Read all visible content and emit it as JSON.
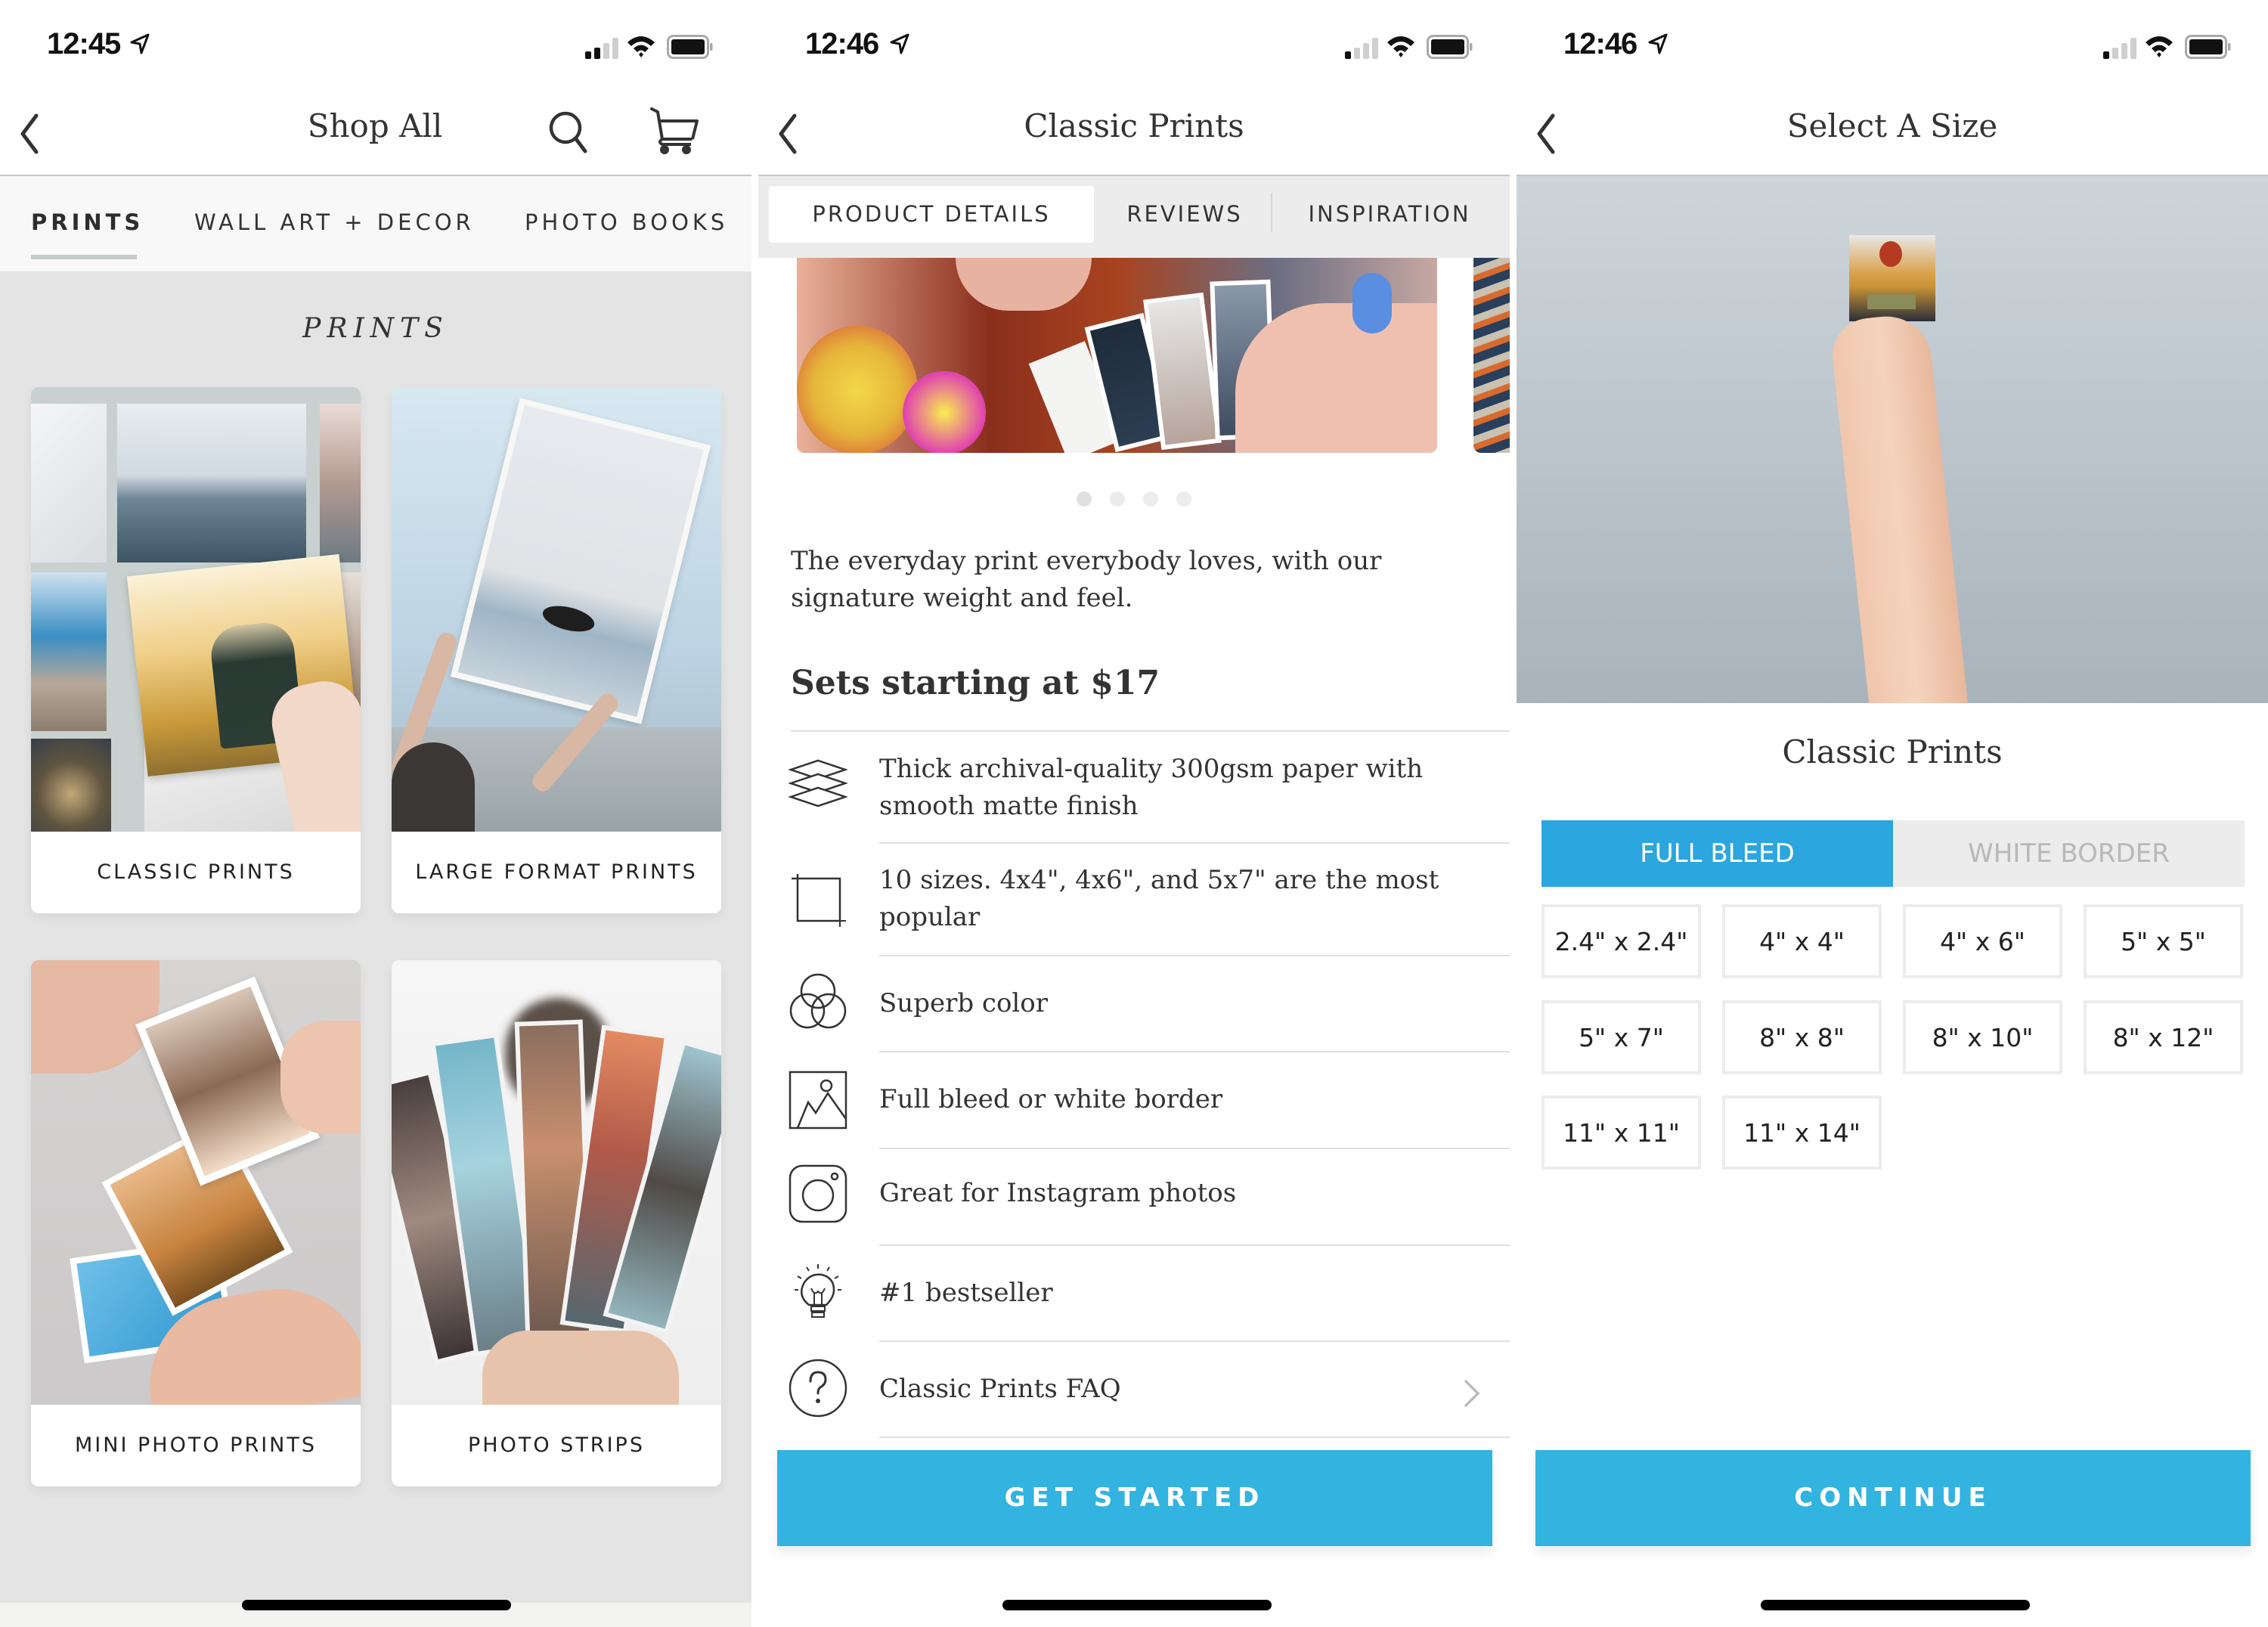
{
  "screens": [
    {
      "status": {
        "time": "12:45",
        "signal_bars_filled": 2,
        "signal_bars_total": 4
      },
      "nav": {
        "title": "Shop All",
        "back_icon": "chevron-left-icon",
        "search_icon": "search-icon",
        "cart_icon": "cart-icon"
      },
      "tabs": [
        {
          "label": "PRINTS",
          "active": true
        },
        {
          "label": "WALL ART + DECOR",
          "active": false
        },
        {
          "label": "PHOTO BOOKS",
          "active": false
        }
      ],
      "section_heading": "PRINTS",
      "products": [
        {
          "label": "CLASSIC PRINTS"
        },
        {
          "label": "LARGE FORMAT PRINTS"
        },
        {
          "label": "MINI PHOTO PRINTS"
        },
        {
          "label": "PHOTO STRIPS"
        }
      ]
    },
    {
      "status": {
        "time": "12:46",
        "signal_bars_filled": 1,
        "signal_bars_total": 4
      },
      "nav": {
        "title": "Classic Prints",
        "back_icon": "chevron-left-icon"
      },
      "tabs": [
        {
          "label": "PRODUCT DETAILS",
          "active": true
        },
        {
          "label": "REVIEWS",
          "active": false
        },
        {
          "label": "INSPIRATION",
          "active": false
        }
      ],
      "carousel": {
        "slide_count": 4,
        "active_index": 0
      },
      "description": "The everyday print everybody loves, with our signature weight and feel.",
      "price_heading": "Sets starting at $17",
      "features": [
        {
          "icon": "layers-icon",
          "text": "Thick archival-quality 300gsm paper with smooth matte finish"
        },
        {
          "icon": "crop-frame-icon",
          "text": "10 sizes. 4x4\", 4x6\", and 5x7\" are the most popular"
        },
        {
          "icon": "color-circles-icon",
          "text": "Superb color"
        },
        {
          "icon": "image-frame-icon",
          "text": "Full bleed or white border"
        },
        {
          "icon": "instagram-icon",
          "text": "Great for Instagram photos"
        },
        {
          "icon": "lightbulb-icon",
          "text": "#1 bestseller"
        },
        {
          "icon": "question-circle-icon",
          "text": "Classic Prints FAQ",
          "has_chevron": true
        }
      ],
      "cta": "GET STARTED"
    },
    {
      "status": {
        "time": "12:46",
        "signal_bars_filled": 1,
        "signal_bars_total": 4
      },
      "nav": {
        "title": "Select A Size",
        "back_icon": "chevron-left-icon"
      },
      "product_name": "Classic Prints",
      "border_options": [
        {
          "label": "FULL BLEED",
          "selected": true
        },
        {
          "label": "WHITE BORDER",
          "selected": false
        }
      ],
      "sizes": [
        "2.4\" x 2.4\"",
        "4\" x 4\"",
        "4\" x 6\"",
        "5\" x 5\"",
        "5\" x 7\"",
        "8\" x 8\"",
        "8\" x 10\"",
        "8\" x 12\"",
        "11\" x 11\"",
        "11\" x 14\""
      ],
      "cta": "CONTINUE"
    }
  ],
  "colors": {
    "accent_blue": "#32b3e0",
    "toggle_selected": "#2ba6de",
    "panel1_background": "#e3e4e3",
    "tab_underline": "#c5cbca",
    "text_dark": "#333333"
  }
}
